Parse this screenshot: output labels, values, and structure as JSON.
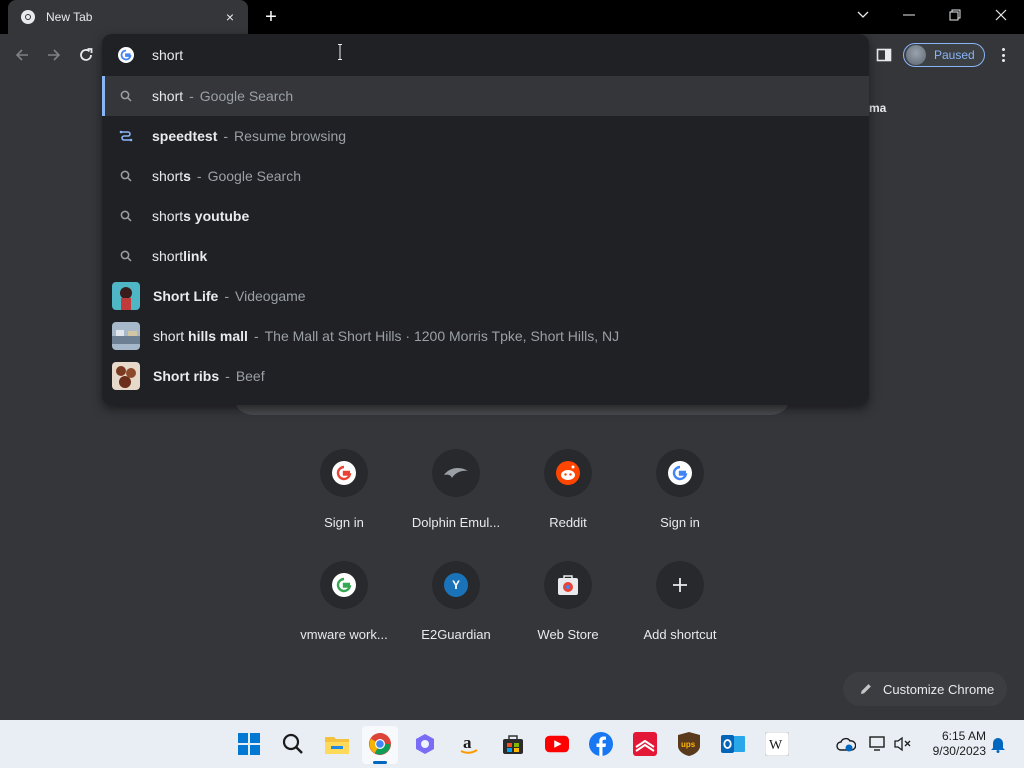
{
  "window": {
    "tab_title": "New Tab",
    "tab_close": "×",
    "new_tab": "+"
  },
  "toolbar": {
    "profile_label": "Paused"
  },
  "omnibox": {
    "input_text": "short",
    "suggestions": [
      {
        "icon": "search-icon",
        "bold": "",
        "normal": "short",
        "desc": "Google Search"
      },
      {
        "icon": "journey-icon",
        "bold": "s",
        "normal": "peedtest",
        "desc": "Resume browsing"
      },
      {
        "icon": "search-icon",
        "bold": "",
        "normal": "short",
        "bold2": "s",
        "desc": "Google Search"
      },
      {
        "icon": "search-icon",
        "normal": "short",
        "bold2": "s youtube",
        "desc": ""
      },
      {
        "icon": "search-icon",
        "normal": "short",
        "bold2": "link",
        "desc": ""
      },
      {
        "icon": "thumbnail",
        "normal": "Short",
        "bold2": " Life",
        "desc": "Videogame"
      },
      {
        "icon": "thumbnail",
        "normal": "short",
        "bold2": " hills mall",
        "desc": "The Mall at Short Hills · 1200 Morris Tpke, Short Hills, NJ"
      },
      {
        "icon": "thumbnail",
        "normal": "Short",
        "bold2": " ribs",
        "desc": "Beef"
      }
    ]
  },
  "page": {
    "partial_right_text": "ma",
    "shortcuts": [
      {
        "label": "Sign in",
        "icon": "google-icon"
      },
      {
        "label": "Dolphin Emul...",
        "icon": "dolphin-icon"
      },
      {
        "label": "Reddit",
        "icon": "reddit-icon"
      },
      {
        "label": "Sign in",
        "icon": "google-icon"
      },
      {
        "label": "vmware work...",
        "icon": "google-icon"
      },
      {
        "label": "E2Guardian",
        "icon": "letter-y-icon",
        "letter": "Y"
      },
      {
        "label": "Web Store",
        "icon": "webstore-icon"
      },
      {
        "label": "Add shortcut",
        "icon": "plus-icon"
      }
    ],
    "customize_label": "Customize Chrome"
  },
  "taskbar": {
    "time": "6:15 AM",
    "date": "9/30/2023",
    "apps": [
      "start-icon",
      "search-icon",
      "file-explorer-icon",
      "chrome-icon",
      "copilot-icon",
      "amazon-icon",
      "store-icon",
      "youtube-icon",
      "facebook-icon",
      "bank-of-america-icon",
      "ups-icon",
      "outlook-icon",
      "wikipedia-icon"
    ]
  },
  "colors": {
    "accent": "#8ab4f8",
    "background": "#35363a",
    "dropdown": "#202124"
  }
}
